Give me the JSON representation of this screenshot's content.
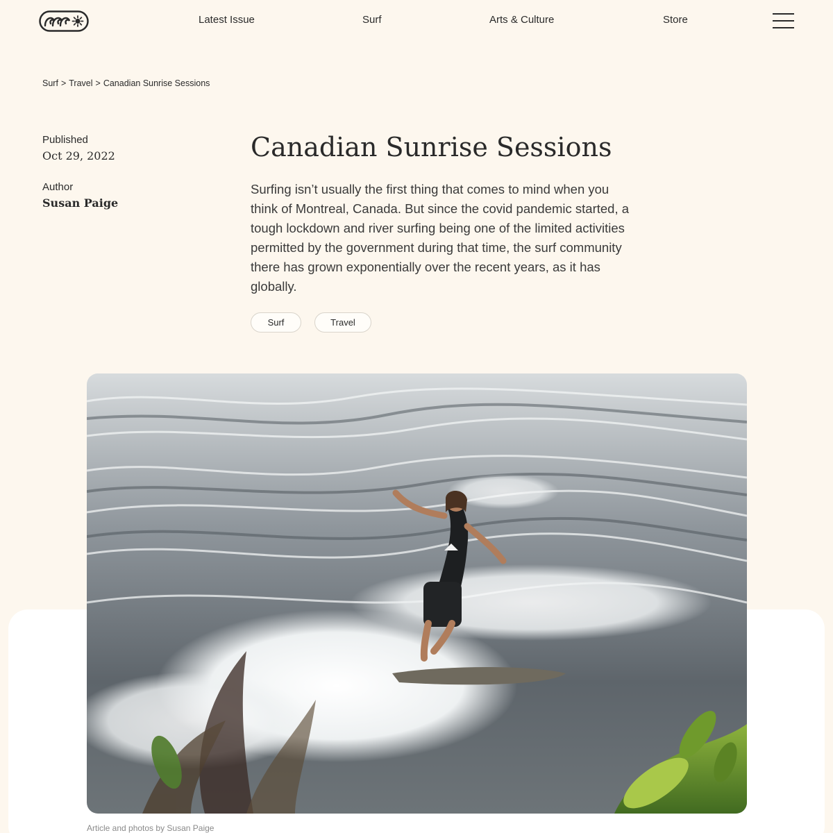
{
  "header": {
    "nav": {
      "latest_issue": "Latest Issue",
      "surf": "Surf",
      "arts_culture": "Arts & Culture",
      "store": "Store"
    }
  },
  "breadcrumb": {
    "items": [
      "Surf",
      "Travel",
      "Canadian Sunrise Sessions"
    ],
    "separator": ">"
  },
  "meta": {
    "published_label": "Published",
    "published_date": "Oct 29, 2022",
    "author_label": "Author",
    "author_name": "Susan Paige"
  },
  "article": {
    "title": "Canadian Sunrise Sessions",
    "lead": "Surfing isn’t usually the first thing that comes to mind when you think of Montreal, Canada. But since the covid pandemic started, a tough lockdown and river surfing being one of the limited activities permitted by the government during that time, the surf community there has grown exponentially over the recent years, as it has globally.",
    "tags": [
      "Surf",
      "Travel"
    ],
    "caption": "Article and photos by Susan Paige"
  },
  "colors": {
    "background": "#fdf7ee",
    "text": "#2a2a2a",
    "panel": "#ffffff"
  }
}
